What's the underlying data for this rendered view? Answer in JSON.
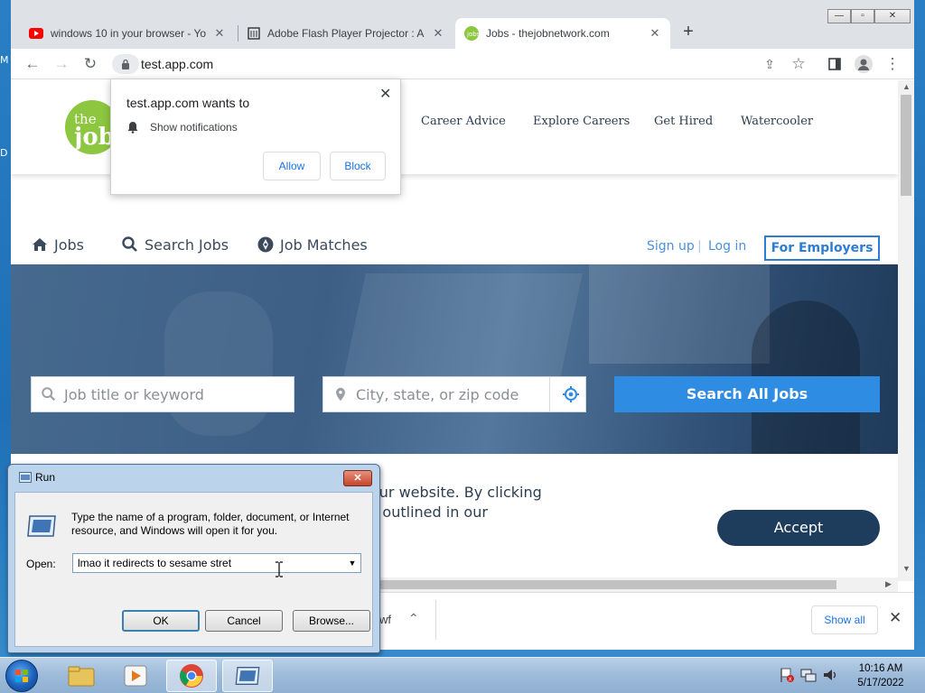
{
  "desktop": {
    "edge_top": "M",
    "edge_mid": "D"
  },
  "browser": {
    "tabs": [
      {
        "title": "windows 10 in your browser - Yo",
        "icon": "youtube-icon"
      },
      {
        "title": "Adobe Flash Player Projector : Ac",
        "icon": "archive-icon"
      },
      {
        "title": "Jobs - thejobnetwork.com",
        "icon": "jobs-icon"
      }
    ],
    "url": "test.app.com"
  },
  "notification": {
    "title": "test.app.com wants to",
    "item": "Show notifications",
    "allow": "Allow",
    "block": "Block"
  },
  "site": {
    "logo_small": "the",
    "logo_big": "job",
    "nav": [
      "Career Advice",
      "Explore Careers",
      "Get Hired",
      "Watercooler"
    ],
    "subnav": [
      "Jobs",
      "Search Jobs",
      "Job Matches"
    ],
    "signup": "Sign up",
    "divider": "|",
    "login": "Log in",
    "employers": "For Employers",
    "search_placeholder": "Job title or keyword",
    "location_placeholder": "City, state, or zip code",
    "search_button": "Search All Jobs",
    "cookie_line1": "our website. By clicking",
    "cookie_line2": "s outlined in our",
    "accept": "Accept"
  },
  "downloads": {
    "partial_name": "wf",
    "show_all": "Show all"
  },
  "run_dialog": {
    "title": "Run",
    "description": "Type the name of a program, folder, document, or Internet resource, and Windows will open it for you.",
    "open_label": "Open:",
    "input_value": "lmao it redirects to sesame stret",
    "ok": "OK",
    "cancel": "Cancel",
    "browse": "Browse..."
  },
  "taskbar": {
    "time": "10:16 AM",
    "date": "5/17/2022"
  },
  "colors": {
    "site_blue": "#2f8ce3",
    "accept_bg": "#1e3d5c",
    "logo_green": "#8dc63f"
  }
}
